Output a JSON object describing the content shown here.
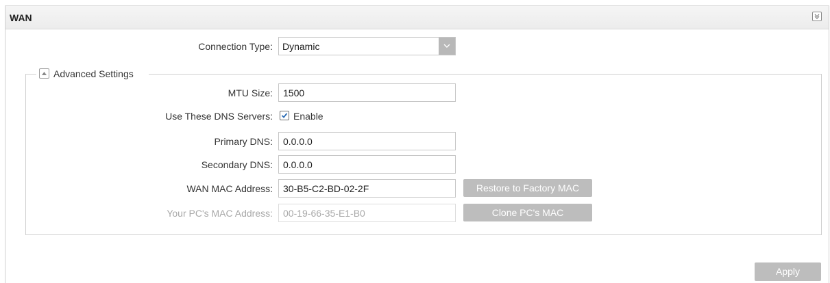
{
  "panel": {
    "title": "WAN",
    "collapse_icon": "chevron-double-down-icon"
  },
  "connection": {
    "label": "Connection Type:",
    "value": "Dynamic",
    "dropdown_icon": "chevron-down-icon"
  },
  "advanced": {
    "legend": "Advanced Settings",
    "toggle_icon": "triangle-up-icon",
    "mtu_label": "MTU Size:",
    "mtu_value": "1500",
    "dns_label": "Use These DNS Servers:",
    "dns_checkbox_label": "Enable",
    "dns_checked": true,
    "primary_dns_label": "Primary DNS:",
    "primary_dns_value": "0.0.0.0",
    "secondary_dns_label": "Secondary DNS:",
    "secondary_dns_value": "0.0.0.0",
    "wan_mac_label": "WAN MAC Address:",
    "wan_mac_value": "30-B5-C2-BD-02-2F",
    "restore_button": "Restore to Factory MAC",
    "pc_mac_label": "Your PC's MAC Address:",
    "pc_mac_value": "00-19-66-35-E1-B0",
    "clone_button": "Clone PC's MAC"
  },
  "footer": {
    "apply_button": "Apply"
  },
  "colors": {
    "button_bg": "#bdbdbd",
    "disabled_text": "#a8a8a8",
    "border": "#cfcfcf"
  }
}
